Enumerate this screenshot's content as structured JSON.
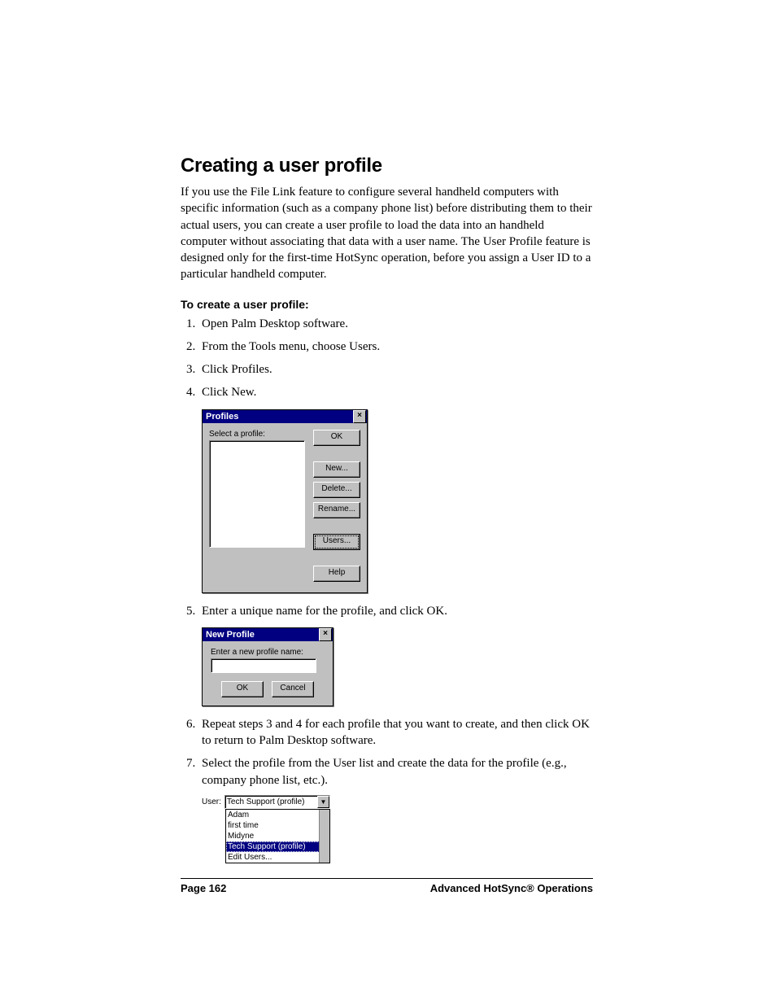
{
  "heading": "Creating a user profile",
  "intro": "If you use the File Link feature to configure several handheld computers with specific information (such as a company phone list) before distributing them to their actual users, you can create a user profile to load the data into an handheld computer without associating that data with a user name. The User Profile feature is designed only for the first-time HotSync operation, before you assign a User ID to a particular handheld computer.",
  "subhead": "To create a user profile:",
  "steps": {
    "s1": "Open Palm Desktop software.",
    "s2": "From the Tools menu, choose Users.",
    "s3": "Click Profiles.",
    "s4": "Click New.",
    "s5": "Enter a unique name for the profile, and click OK.",
    "s6": "Repeat steps 3 and 4 for each profile that you want to create, and then click OK to return to Palm Desktop software.",
    "s7": "Select the profile from the User list and create the data for the profile (e.g., company phone list, etc.)."
  },
  "profiles_dialog": {
    "title": "Profiles",
    "label": "Select a profile:",
    "buttons": {
      "ok": "OK",
      "new": "New...",
      "delete": "Delete...",
      "rename": "Rename...",
      "users": "Users...",
      "help": "Help"
    }
  },
  "newprofile_dialog": {
    "title": "New Profile",
    "label": "Enter a new profile name:",
    "ok": "OK",
    "cancel": "Cancel"
  },
  "user_dropdown": {
    "label": "User:",
    "selected": "Tech Support (profile)",
    "items": {
      "i0": "Adam",
      "i1": "first time",
      "i2": "Midyne",
      "i3": "Tech Support (profile)",
      "i4": "Edit Users..."
    }
  },
  "footer": {
    "page": "Page 162",
    "section": "Advanced HotSync® Operations"
  }
}
